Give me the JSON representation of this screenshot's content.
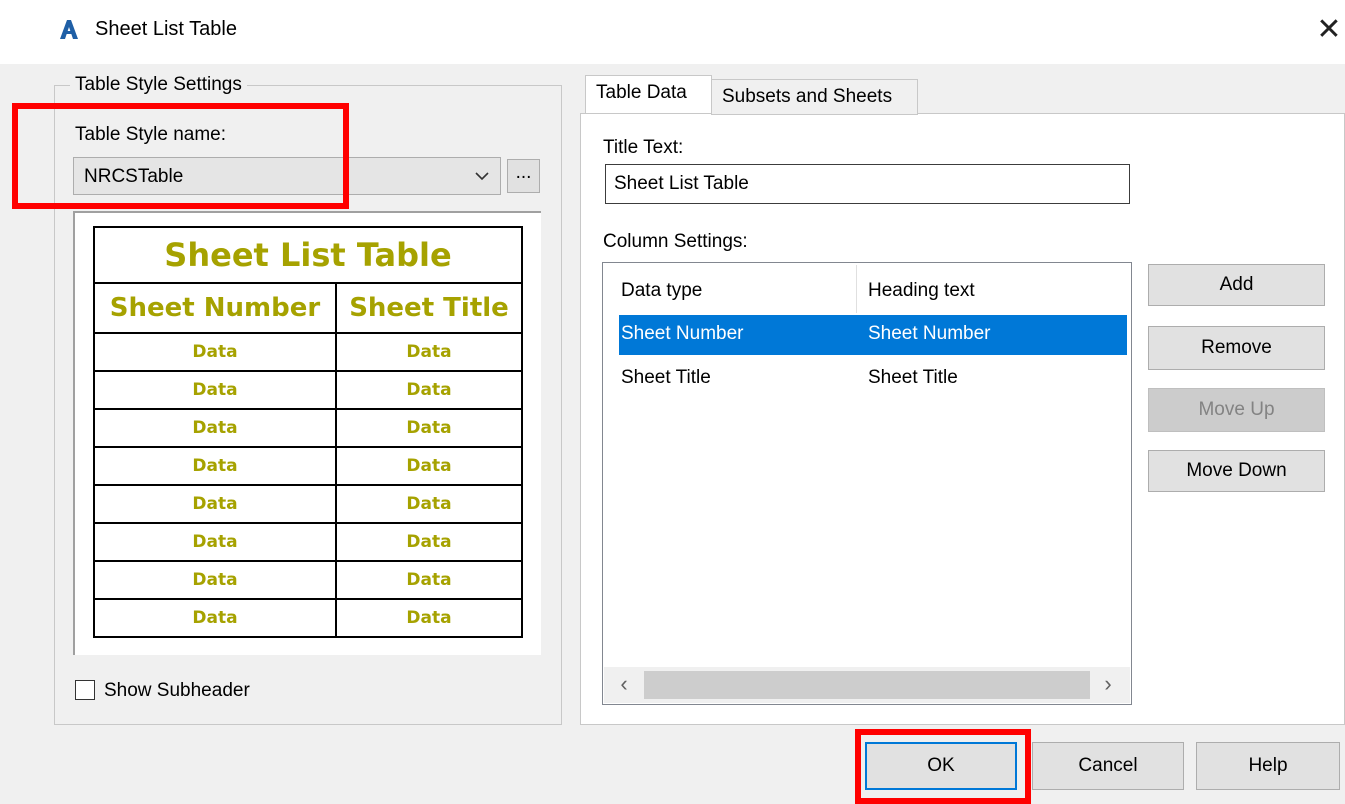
{
  "window": {
    "title": "Sheet List Table",
    "app_icon": "autocad-a-icon",
    "close_glyph": "✕"
  },
  "table_style_settings": {
    "group_label": "Table Style Settings",
    "style_name_label": "Table Style name:",
    "style_name_value": "NRCSTable",
    "browse_label": "...",
    "preview": {
      "title": "Sheet List Table",
      "headers": [
        "Sheet Number",
        "Sheet Title"
      ],
      "cell_text": "Data",
      "row_count": 8,
      "text_color": "#a6a200"
    },
    "show_subheader_label": "Show Subheader",
    "show_subheader_checked": false
  },
  "tabs": [
    {
      "label": "Table Data",
      "active": true
    },
    {
      "label": "Subsets and Sheets",
      "active": false
    }
  ],
  "table_data": {
    "title_text_label": "Title Text:",
    "title_text_value": "Sheet List Table",
    "column_settings_label": "Column Settings:",
    "columns_header": [
      "Data type",
      "Heading text"
    ],
    "rows": [
      {
        "data_type": "Sheet Number",
        "heading": "Sheet Number",
        "selected": true
      },
      {
        "data_type": "Sheet Title",
        "heading": "Sheet Title",
        "selected": false
      }
    ],
    "buttons": {
      "add": "Add",
      "remove": "Remove",
      "move_up": "Move Up",
      "move_down": "Move Down"
    }
  },
  "footer": {
    "ok": "OK",
    "cancel": "Cancel",
    "help": "Help"
  },
  "colors": {
    "selection": "#0078d7",
    "highlight": "#ff0000",
    "dialog_bg": "#f0f0f0"
  }
}
